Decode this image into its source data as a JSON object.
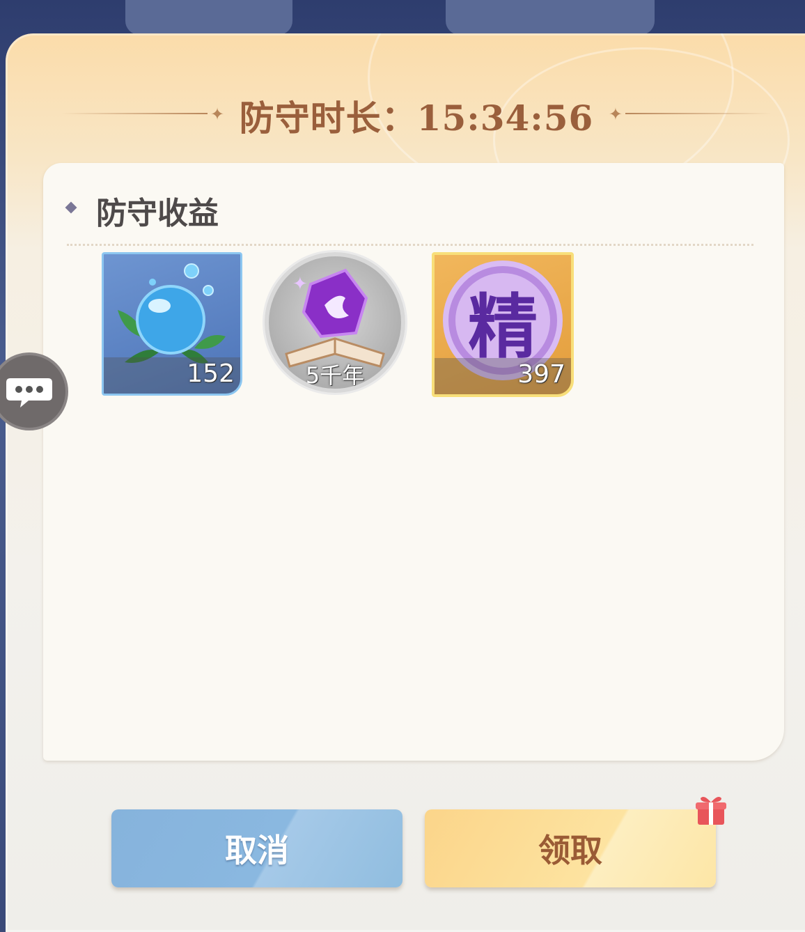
{
  "dialog": {
    "title": "防守时长：15:34:56"
  },
  "rewards": {
    "section_title": "防守收益",
    "items": [
      {
        "name": "water-droplet-flower",
        "count": "152",
        "frame": "blue"
      },
      {
        "name": "experience-tome-purple-gem",
        "count": "5千年",
        "frame": "gray"
      },
      {
        "name": "jing-coin",
        "count": "397",
        "frame": "gold",
        "glyph": "精"
      }
    ]
  },
  "buttons": {
    "cancel_label": "取消",
    "claim_label": "领取"
  },
  "colors": {
    "title": "#9a5f3c",
    "cancel_button": "#86b3dc",
    "claim_button": "#fbd58a",
    "panel": "#fbf9f3"
  },
  "icons": {
    "chat": "chat-bubble-icon",
    "gift": "gift-icon"
  }
}
